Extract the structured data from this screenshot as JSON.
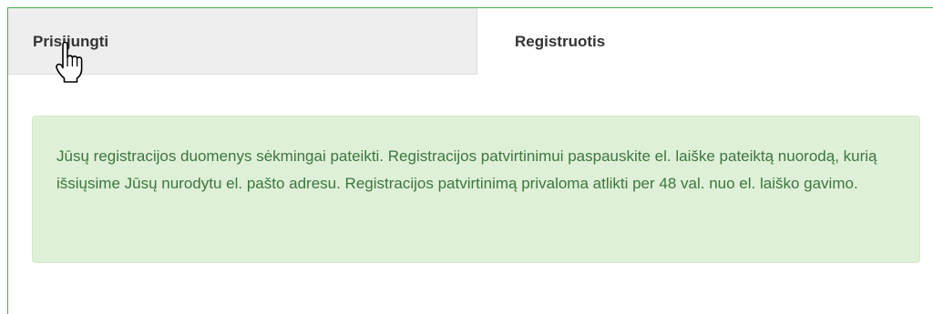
{
  "tabs": [
    {
      "label": "Prisijungti",
      "active": false
    },
    {
      "label": "Registruotis",
      "active": true
    }
  ],
  "alert": {
    "message": "Jūsų registracijos duomenys sėkmingai pateikti. Registracijos patvirtinimui paspauskite el. laiške pateiktą nuorodą, kurią išsiųsime Jūsų nurodytu el. pašto adresu. Registracijos patvirtinimą privaloma atlikti per 48 val. nuo el. laiško gavimo."
  },
  "colors": {
    "panel_border": "#4cae4c",
    "inactive_tab_bg": "#eeeeee",
    "alert_bg": "#dff0d8",
    "alert_border": "#d6e9c6",
    "alert_text": "#3c763d"
  },
  "cursor": {
    "icon": "hand-pointer-icon"
  }
}
